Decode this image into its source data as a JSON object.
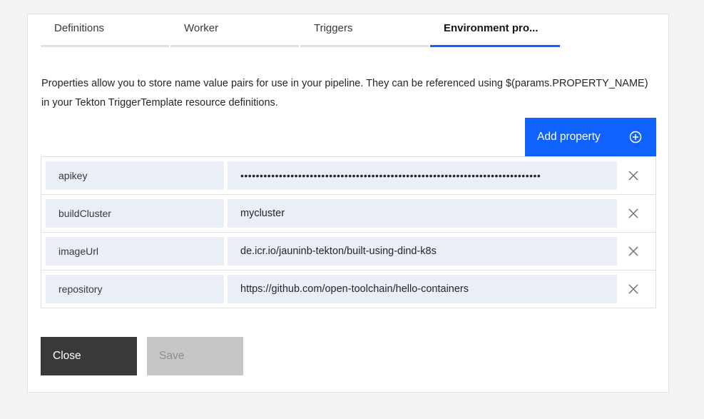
{
  "tabs": [
    {
      "label": "Definitions",
      "active": false
    },
    {
      "label": "Worker",
      "active": false
    },
    {
      "label": "Triggers",
      "active": false
    },
    {
      "label": "Environment pro...",
      "active": true
    }
  ],
  "description": "Properties allow you to store name value pairs for use in your pipeline. They can be referenced using $(params.PROPERTY_NAME) in your Tekton TriggerTemplate resource definitions.",
  "add_property": {
    "label": "Add property",
    "icon": "add-circle-icon"
  },
  "properties": [
    {
      "name": "apikey",
      "value": "••••••••••••••••••••••••••••••••••••••••••••••••••••••••••••••••••••••••••••••",
      "secure": true
    },
    {
      "name": "buildCluster",
      "value": "mycluster",
      "secure": false
    },
    {
      "name": "imageUrl",
      "value": "de.icr.io/jauninb-tekton/built-using-dind-k8s",
      "secure": false
    },
    {
      "name": "repository",
      "value": "https://github.com/open-toolchain/hello-containers",
      "secure": false
    }
  ],
  "remove_icon": "close-icon",
  "actions": {
    "close_label": "Close",
    "save_label": "Save",
    "save_disabled": true
  },
  "colors": {
    "accent": "#0f62fe",
    "close_bg": "#393939",
    "disabled_bg": "#c6c6c6",
    "field_bg": "#eaeef6"
  }
}
